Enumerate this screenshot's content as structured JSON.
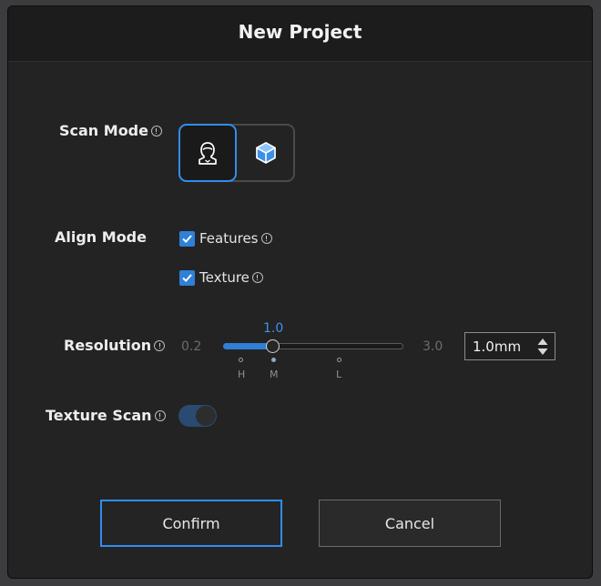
{
  "dialog": {
    "title": "New Project"
  },
  "scan_mode": {
    "label": "Scan Mode",
    "options": [
      {
        "name": "person",
        "icon": "person-icon",
        "selected": true
      },
      {
        "name": "object",
        "icon": "cube-icon",
        "selected": false
      }
    ]
  },
  "align_mode": {
    "label": "Align Mode",
    "features": {
      "label": "Features",
      "checked": true
    },
    "texture": {
      "label": "Texture",
      "checked": true
    }
  },
  "resolution": {
    "label": "Resolution",
    "min": "0.2",
    "max": "3.0",
    "current": "1.0",
    "value": 1.0,
    "ticks": [
      "H",
      "M",
      "L"
    ],
    "active_tick": "M",
    "input_value": "1.0mm"
  },
  "texture_scan": {
    "label": "Texture Scan",
    "enabled": false
  },
  "buttons": {
    "confirm": "Confirm",
    "cancel": "Cancel"
  },
  "colors": {
    "accent": "#2f8ef0",
    "background": "#232323",
    "titlebar": "#1c1c1c"
  }
}
